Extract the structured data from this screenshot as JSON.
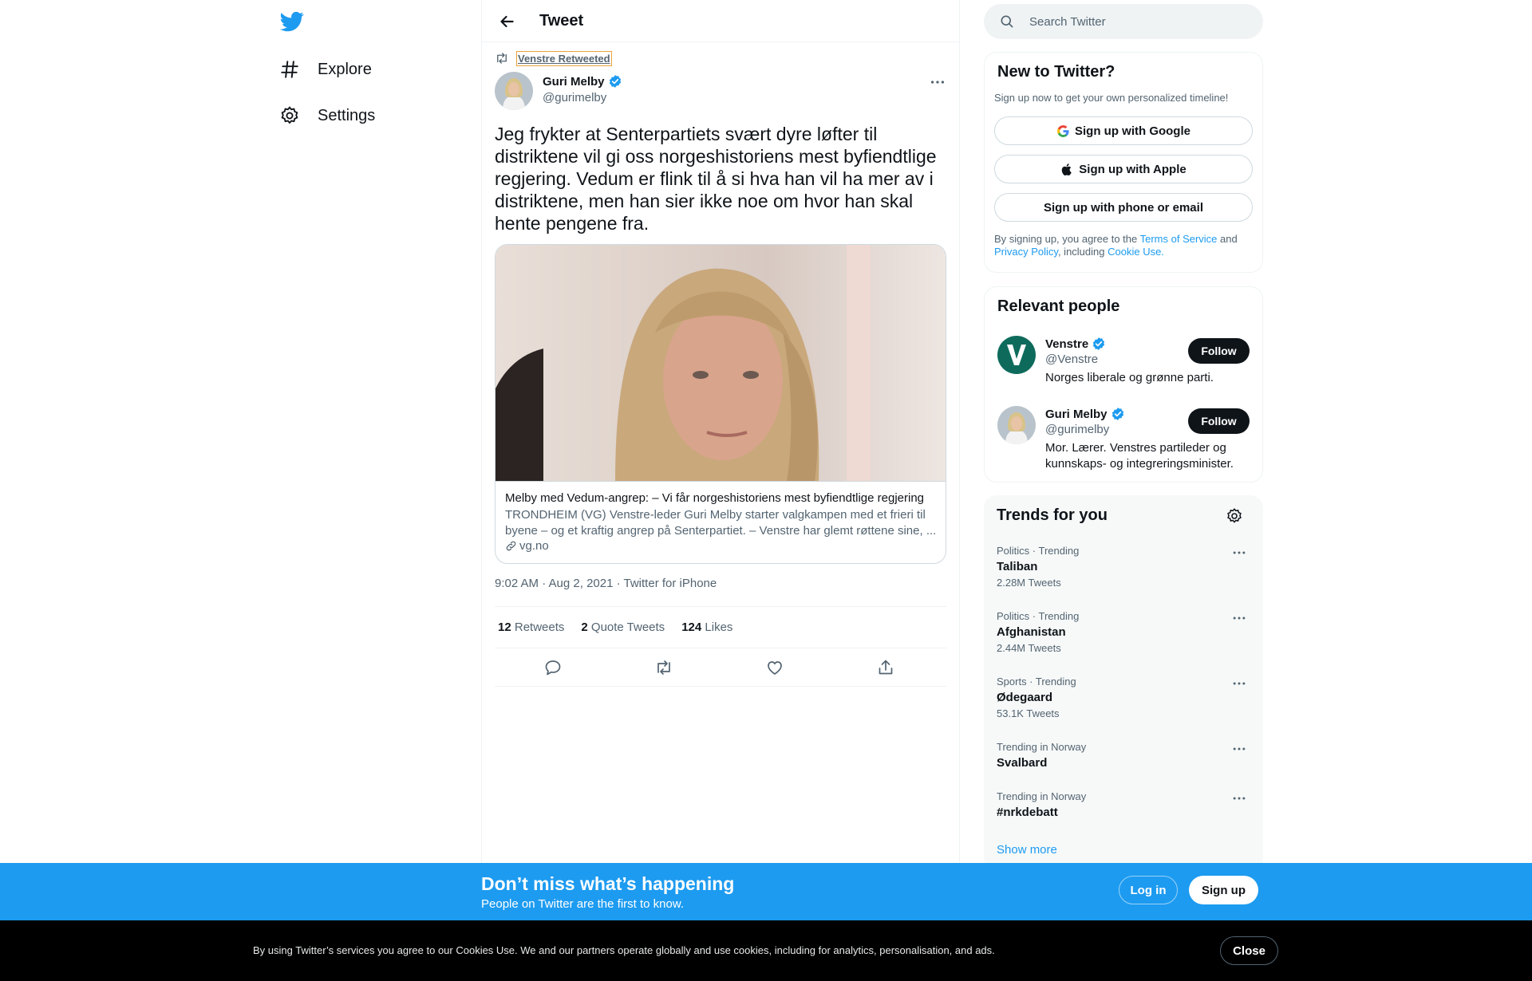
{
  "nav": {
    "items": [
      {
        "label": "Explore",
        "icon": "hashtag-icon"
      },
      {
        "label": "Settings",
        "icon": "gear-icon"
      }
    ]
  },
  "header": {
    "title": "Tweet"
  },
  "tweet": {
    "retweeted_by": "Venstre Retweeted",
    "author_name": "Guri Melby",
    "author_handle": "@gurimelby",
    "text": "Jeg frykter at Senterpartiets svært dyre løfter til distriktene vil gi oss norgeshistoriens mest byfiendtlige regjering. Vedum er flink til å si hva han vil ha mer av i distriktene, men han sier ikke noe om hvor han skal hente pengene fra.",
    "card": {
      "title": "Melby med Vedum-angrep: – Vi får norgeshistoriens mest byfiendtlige regjering",
      "description": "TRONDHEIM (VG) Venstre-leder Guri Melby starter valgkampen med et frieri til byene – og et kraftig angrep på Senterpartiet. – Venstre har glemt røttene sine, ...",
      "domain": "vg.no"
    },
    "time": "9:02 AM · Aug 2, 2021",
    "source": "Twitter for iPhone",
    "stats": {
      "retweets_count": "12",
      "retweets_label": "Retweets",
      "quotes_count": "2",
      "quotes_label": "Quote Tweets",
      "likes_count": "124",
      "likes_label": "Likes"
    }
  },
  "search": {
    "placeholder": "Search Twitter"
  },
  "new_to_twitter": {
    "title": "New to Twitter?",
    "subtitle": "Sign up now to get your own personalized timeline!",
    "google": "Sign up with Google",
    "apple": "Sign up with Apple",
    "phone": "Sign up with phone or email",
    "legal_1": "By signing up, you agree to the ",
    "terms": "Terms of Service",
    "legal_2": " and ",
    "privacy": "Privacy Policy",
    "legal_3": ", including ",
    "cookie": "Cookie Use."
  },
  "relevant": {
    "title": "Relevant people",
    "people": [
      {
        "name": "Venstre",
        "handle": "@Venstre",
        "bio": "Norges liberale og grønne parti.",
        "follow": "Follow"
      },
      {
        "name": "Guri Melby",
        "handle": "@gurimelby",
        "bio": "Mor. Lærer. Venstres partileder og kunnskaps- og integreringsminister.",
        "follow": "Follow"
      }
    ]
  },
  "trends": {
    "title": "Trends for you",
    "items": [
      {
        "context": "Politics · Trending",
        "name": "Taliban",
        "count": "2.28M Tweets"
      },
      {
        "context": "Politics · Trending",
        "name": "Afghanistan",
        "count": "2.44M Tweets"
      },
      {
        "context": "Sports · Trending",
        "name": "Ødegaard",
        "count": "53.1K Tweets"
      },
      {
        "context": "Trending in Norway",
        "name": "Svalbard",
        "count": ""
      },
      {
        "context": "Trending in Norway",
        "name": "#nrkdebatt",
        "count": ""
      }
    ],
    "show_more": "Show more"
  },
  "banner": {
    "title": "Don’t miss what’s happening",
    "subtitle": "People on Twitter are the first to know.",
    "login": "Log in",
    "signup": "Sign up"
  },
  "cookie_bar": {
    "text": "By using Twitter’s services you agree to our Cookies Use. We and our partners operate globally and use cookies, including for analytics, personalisation, and ads.",
    "close": "Close"
  },
  "colors": {
    "accent": "#1d9bf0",
    "text": "#0f1419",
    "muted": "#536471",
    "border": "#eff3f4"
  }
}
